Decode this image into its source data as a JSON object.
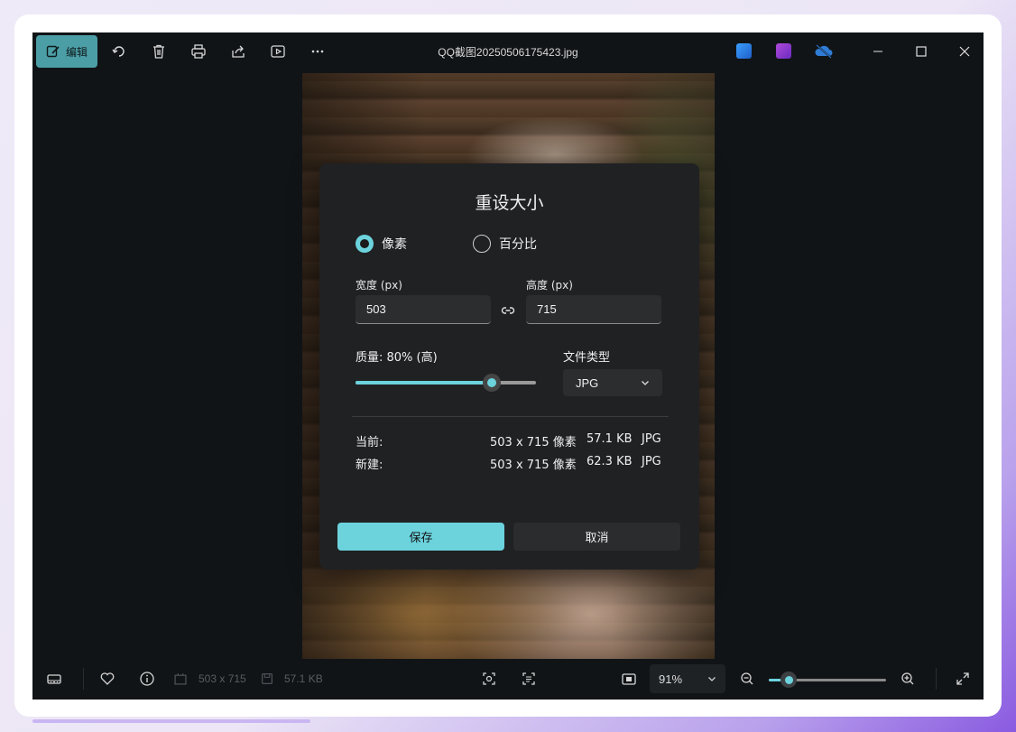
{
  "window": {
    "title": "QQ截图20250506175423.jpg",
    "edit_label": "编辑"
  },
  "toolbar_icons": [
    "edit-icon",
    "rotate-icon",
    "delete-icon",
    "print-icon",
    "share-icon",
    "slideshow-icon",
    "more-icon"
  ],
  "app_badges": [
    "photo-editor-badge",
    "clipchamp-badge",
    "onedrive-offline-badge"
  ],
  "colors": {
    "accent": "#6cd3dd",
    "edit_button": "#4c9ea6",
    "dialog_bg": "#202123",
    "window_bg": "#111417"
  },
  "dialog": {
    "title": "重设大小",
    "mode_pixels": "像素",
    "mode_percent": "百分比",
    "selected_mode": "像素",
    "width_label": "宽度 (px)",
    "width_value": "503",
    "height_label": "高度 (px)",
    "height_value": "715",
    "quality_label": "质量: 80% (高)",
    "quality_percent": 80,
    "file_type_label": "文件类型",
    "file_type_value": "JPG",
    "current": {
      "label": "当前:",
      "dimensions": "503 x 715 像素",
      "size": "57.1 KB",
      "type": "JPG"
    },
    "new": {
      "label": "新建:",
      "dimensions": "503 x 715 像素",
      "size": "62.3 KB",
      "type": "JPG"
    },
    "save_label": "保存",
    "cancel_label": "取消"
  },
  "status_bar": {
    "dimensions": "503 x 715",
    "file_size": "57.1 KB",
    "zoom_value": "91%",
    "zoom_fraction": 0.17
  }
}
